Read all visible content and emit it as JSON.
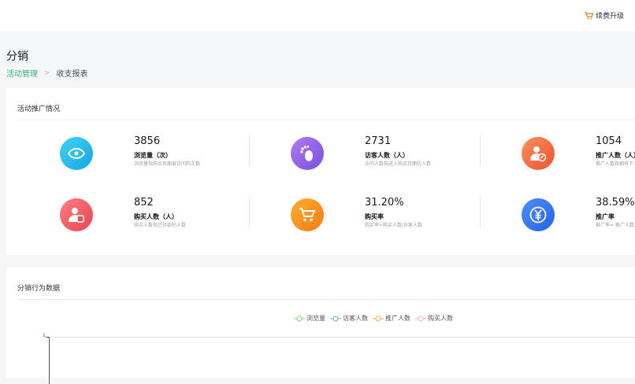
{
  "header": {
    "renew_label": "续费升级",
    "icon": "cart-icon"
  },
  "page": {
    "title": "分销"
  },
  "breadcrumb": {
    "parent": "活动管理",
    "separator": ">",
    "current": "收支报表"
  },
  "promotion": {
    "title": "活动推广情况",
    "stats": [
      {
        "value": "3856",
        "label": "浏览量（次）",
        "desc": "浏览量指购买页面被访问的次数",
        "icon": "eye-icon",
        "color_from": "#3fd3f2",
        "color_to": "#16a6e4"
      },
      {
        "value": "2731",
        "label": "访客人数（人）",
        "desc": "访问人数指进入购买页面的人数",
        "icon": "footprint-icon",
        "color_from": "#b07cf3",
        "color_to": "#7a4fe0"
      },
      {
        "value": "1054",
        "label": "推广人数（人）",
        "desc": "推广人数指拥有下…",
        "icon": "promoter-icon",
        "color_from": "#ff8f5c",
        "color_to": "#e9542f"
      },
      {
        "value": "852",
        "label": "购买人数（人）",
        "desc": "购买人数指已付款的人数",
        "icon": "buyer-icon",
        "color_from": "#ff7f86",
        "color_to": "#e9434d"
      },
      {
        "value": "31.20%",
        "label": "购买率",
        "desc": "购买率=购买人数/访客人数",
        "icon": "cart-icon",
        "color_from": "#ffad33",
        "color_to": "#f47c12"
      },
      {
        "value": "38.59%",
        "label": "推广率",
        "desc": "推广率= 推广人数…",
        "icon": "yuan-icon",
        "color_from": "#4c8ff7",
        "color_to": "#2563e6"
      }
    ]
  },
  "behavior": {
    "title": "分销行为数据",
    "legend": [
      {
        "name": "浏览量",
        "color": "#7ed17e"
      },
      {
        "name": "访客人数",
        "color": "#6fa8dc"
      },
      {
        "name": "推广人数",
        "color": "#f2a35a"
      },
      {
        "name": "购买人数",
        "color": "#f7b5b0"
      }
    ],
    "y_tick": "1"
  }
}
